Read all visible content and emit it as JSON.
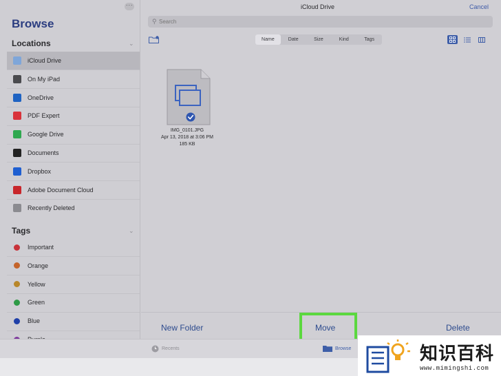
{
  "sidebar": {
    "title": "Browse",
    "locations_heading": "Locations",
    "tags_heading": "Tags",
    "locations": [
      {
        "label": "iCloud Drive",
        "icon": "icloud-icon",
        "color": "#7fa6d9",
        "selected": true
      },
      {
        "label": "On My iPad",
        "icon": "ipad-icon",
        "color": "#4a4a4e",
        "selected": false
      },
      {
        "label": "OneDrive",
        "icon": "onedrive-icon",
        "color": "#1f63c2",
        "selected": false
      },
      {
        "label": "PDF Expert",
        "icon": "pdf-expert-icon",
        "color": "#d9323a",
        "selected": false
      },
      {
        "label": "Google Drive",
        "icon": "google-drive-icon",
        "color": "#2fa84f",
        "selected": false
      },
      {
        "label": "Documents",
        "icon": "documents-icon",
        "color": "#222222",
        "selected": false
      },
      {
        "label": "Dropbox",
        "icon": "dropbox-icon",
        "color": "#1f5fd1",
        "selected": false
      },
      {
        "label": "Adobe Document Cloud",
        "icon": "adobe-icon",
        "color": "#c8262b",
        "selected": false
      },
      {
        "label": "Recently Deleted",
        "icon": "trash-icon",
        "color": "#8b8b90",
        "selected": false
      }
    ],
    "tags": [
      {
        "label": "Important",
        "color": "#c8323a"
      },
      {
        "label": "Orange",
        "color": "#c4642b"
      },
      {
        "label": "Yellow",
        "color": "#b8872a"
      },
      {
        "label": "Green",
        "color": "#2e9a46"
      },
      {
        "label": "Blue",
        "color": "#1f3fa8"
      },
      {
        "label": "Purple",
        "color": "#7e3a9e"
      }
    ]
  },
  "header": {
    "title": "iCloud Drive",
    "cancel_label": "Cancel",
    "search_placeholder": "Search"
  },
  "sort": {
    "options": [
      "Name",
      "Date",
      "Size",
      "Kind",
      "Tags"
    ],
    "active": "Name"
  },
  "file": {
    "name": "IMG_0101.JPG",
    "date": "Apr 13, 2018 at 3:06 PM",
    "size": "185 KB"
  },
  "actions": {
    "new_folder": "New Folder",
    "move": "Move",
    "delete": "Delete"
  },
  "tabs": {
    "recents": "Recents",
    "browse": "Browse"
  },
  "watermark": {
    "chinese": "知识百科",
    "url": "www.mimingshi.com"
  },
  "colors": {
    "accent": "#3e5ea8",
    "highlight": "#5bd83f"
  }
}
